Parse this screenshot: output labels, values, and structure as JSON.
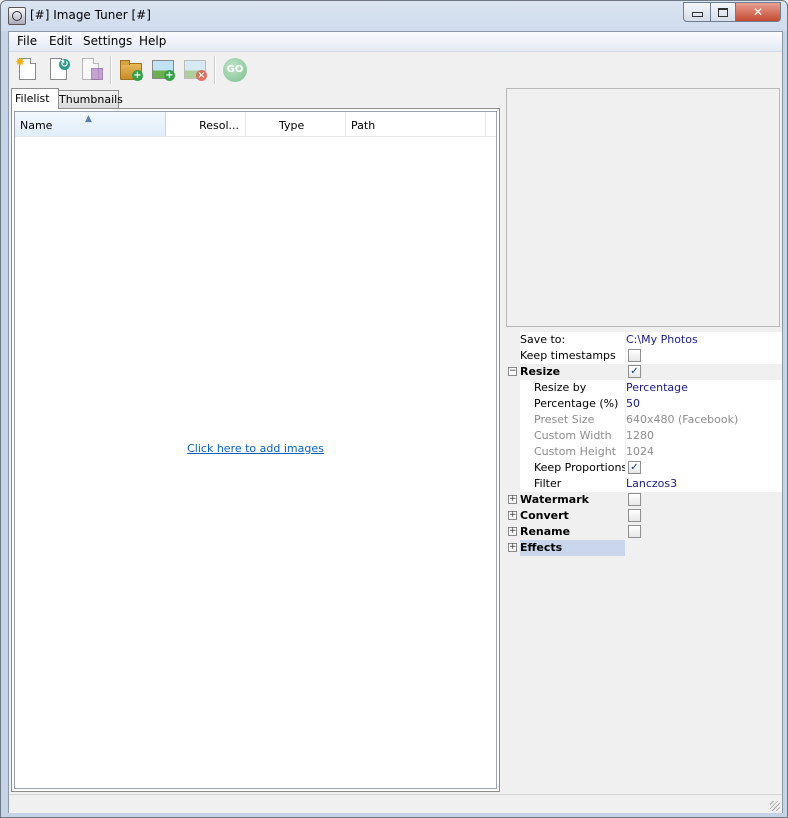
{
  "window": {
    "title": "[#] Image Tuner [#]"
  },
  "menu": [
    {
      "label": "File"
    },
    {
      "label": "Edit"
    },
    {
      "label": "Settings"
    },
    {
      "label": "Help"
    }
  ],
  "toolbar": {
    "go_label": "GO"
  },
  "tabs": [
    {
      "label": "Filelist",
      "active": true
    },
    {
      "label": "Thumbnails",
      "active": false
    }
  ],
  "filelist": {
    "columns": [
      "Name",
      "Resol...",
      "Type",
      "Path"
    ],
    "empty_link": "Click here to add images"
  },
  "properties": {
    "save_to": {
      "label": "Save to:",
      "value": "C:\\My Photos"
    },
    "keep_timestamps": {
      "label": "Keep timestamps",
      "checked": false
    },
    "resize": {
      "label": "Resize",
      "checked": true,
      "expander": "−"
    },
    "resize_by": {
      "label": "Resize by",
      "value": "Percentage"
    },
    "percentage": {
      "label": "Percentage (%)",
      "value": "50"
    },
    "preset_size": {
      "label": "Preset Size",
      "value": "640x480 (Facebook)"
    },
    "custom_width": {
      "label": "Custom Width",
      "value": "1280"
    },
    "custom_height": {
      "label": "Custom Height",
      "value": "1024"
    },
    "keep_proportions": {
      "label": "Keep Proportions",
      "checked": true
    },
    "filter": {
      "label": "Filter",
      "value": "Lanczos3"
    },
    "watermark": {
      "label": "Watermark",
      "checked": false,
      "expander": "+"
    },
    "convert": {
      "label": "Convert",
      "checked": false,
      "expander": "+"
    },
    "rename": {
      "label": "Rename",
      "checked": false,
      "expander": "+"
    },
    "effects": {
      "label": "Effects",
      "expander": "+"
    },
    "check_mark": "✓"
  },
  "colors": {
    "link": "#0b5fbf",
    "value_text": "#1a1a8a",
    "selected_row": "#c9d6ec"
  }
}
